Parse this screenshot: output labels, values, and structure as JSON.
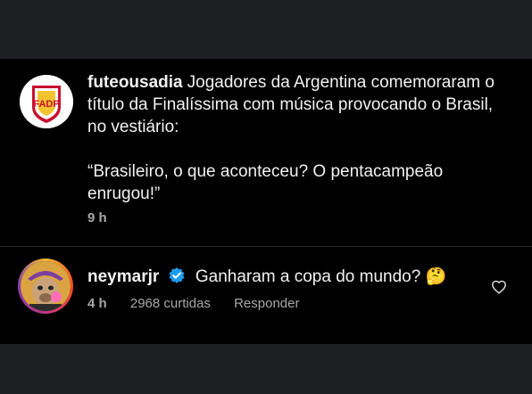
{
  "post": {
    "username": "futeousadia",
    "caption_p1": "Jogadores da Argentina comemoraram o título da Finalíssima com música provocando o Brasil, no vestiário:",
    "caption_p2": "“Brasileiro, o que aconteceu? O pentacampeão enrugou!”",
    "time": "9 h",
    "avatar_text": "FADP"
  },
  "comment": {
    "username": "neymarjr",
    "text": "Ganharam a copa do mundo?",
    "emoji": "🤔",
    "time": "4 h",
    "likes": "2968 curtidas",
    "reply": "Responder"
  },
  "colors": {
    "background": "#000000",
    "band": "#1d1f22",
    "secondary_text": "#a8a8a8",
    "verified": "#1d9bf0"
  },
  "icons": [
    "verified-badge-icon",
    "heart-icon",
    "thinking-face-emoji"
  ]
}
